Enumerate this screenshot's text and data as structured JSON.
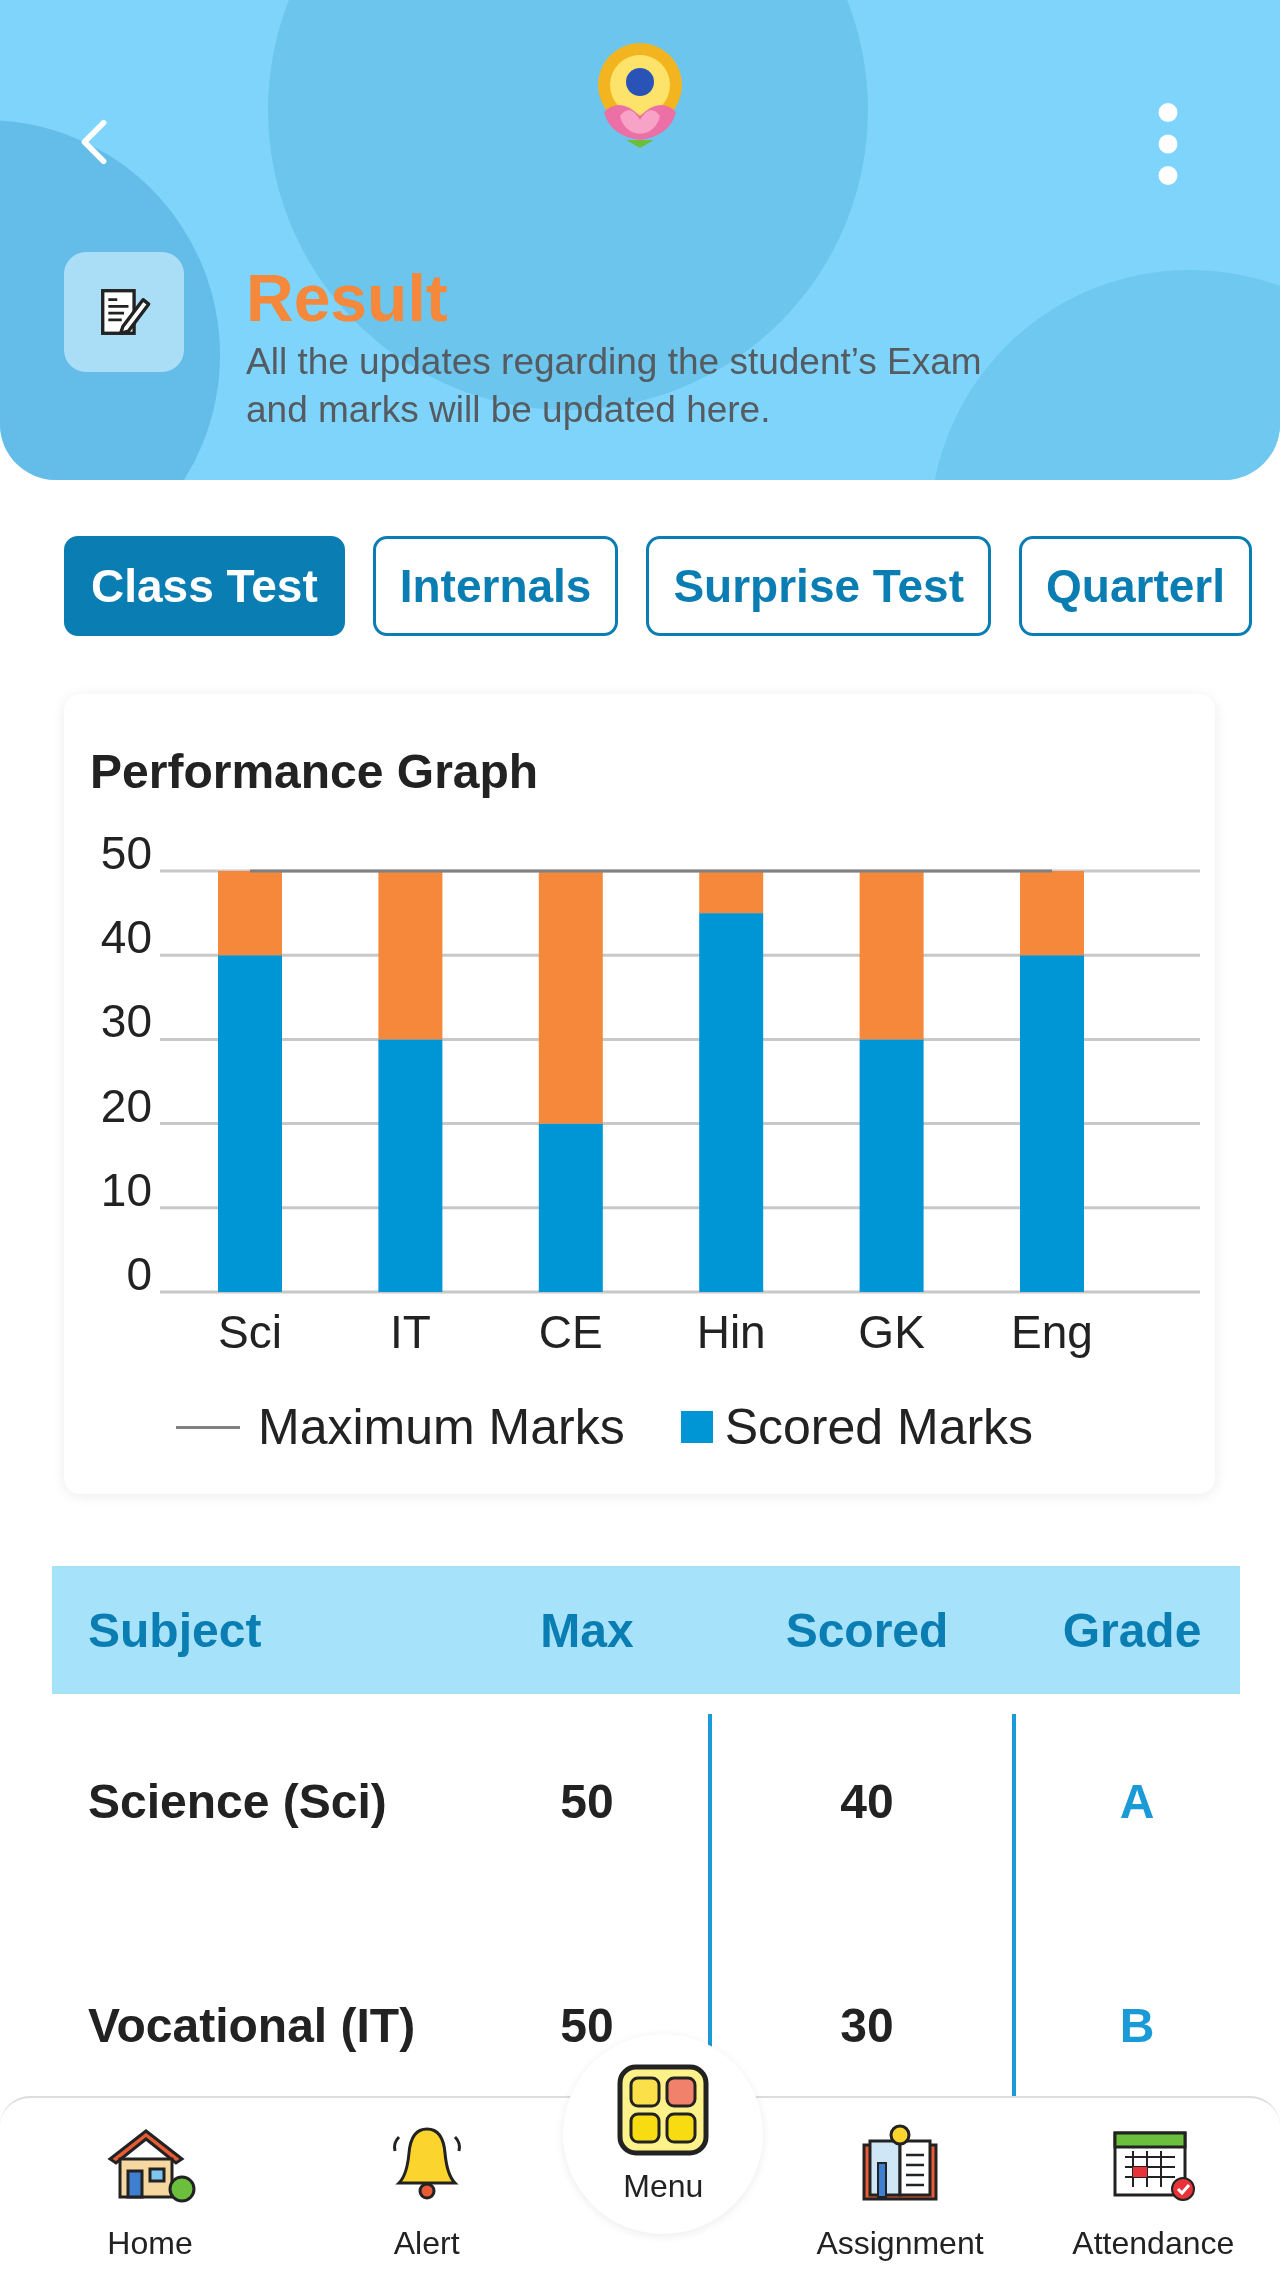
{
  "header": {
    "title": "Result",
    "subtitle": "All the updates regarding the student’s Exam and marks will be updated here."
  },
  "tabs": [
    {
      "label": "Class Test",
      "selected": true
    },
    {
      "label": "Internals",
      "selected": false
    },
    {
      "label": "Surprise Test",
      "selected": false
    },
    {
      "label": "Quarterl",
      "selected": false
    }
  ],
  "chart": {
    "title": "Performance Graph",
    "chart_data": {
      "type": "bar",
      "stacked": true,
      "categories": [
        "Sci",
        "IT",
        "CE",
        "Hin",
        "GK",
        "Eng"
      ],
      "series": [
        {
          "name": "Scored Marks",
          "color": "#0096d6",
          "values": [
            40,
            30,
            20,
            45,
            30,
            40
          ]
        },
        {
          "color": "#f5883a",
          "values": [
            10,
            20,
            30,
            5,
            20,
            10
          ]
        },
        {
          "name": "Maximum Marks",
          "type": "line",
          "color": "#808080",
          "values": [
            50,
            50,
            50,
            50,
            50,
            50
          ]
        }
      ],
      "ylim": [
        0,
        50
      ],
      "yticks": [
        0,
        10,
        20,
        30,
        40,
        50
      ],
      "grid": true
    }
  },
  "table": {
    "columns": [
      "Subject",
      "Max",
      "Scored",
      "Grade"
    ],
    "rows": [
      {
        "subject": "Science (Sci)",
        "max": "50",
        "scored": "40",
        "grade": "A"
      },
      {
        "subject": "Vocational (IT)",
        "max": "50",
        "scored": "30",
        "grade": "B"
      }
    ]
  },
  "nav": [
    {
      "kind": "home",
      "label": "Home"
    },
    {
      "kind": "alert",
      "label": "Alert"
    },
    {
      "kind": "menu",
      "label": "Menu"
    },
    {
      "kind": "assignment",
      "label": "Assignment"
    },
    {
      "kind": "attendance",
      "label": "Attendance"
    }
  ]
}
